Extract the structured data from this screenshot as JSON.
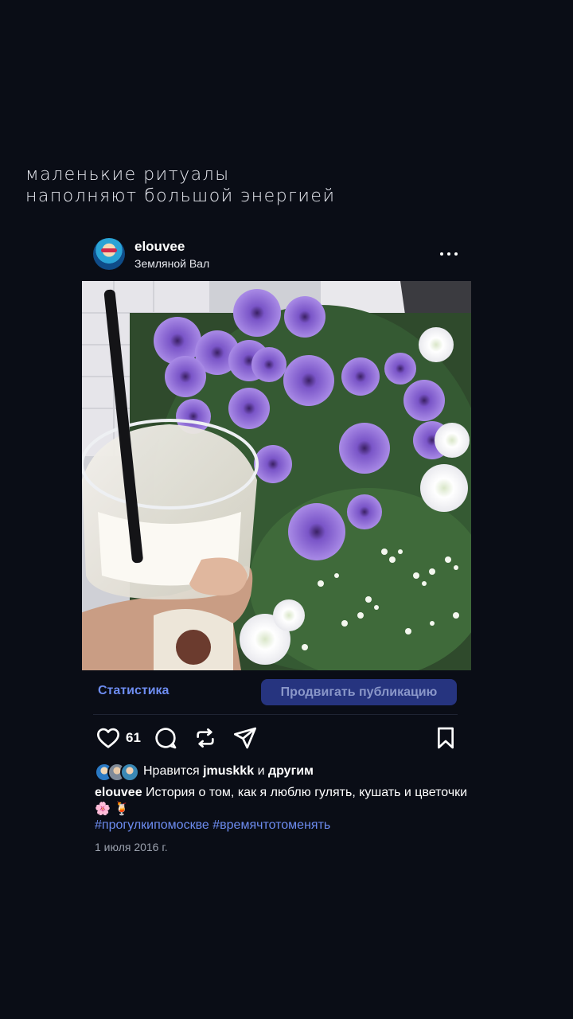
{
  "quote": {
    "line1": "маленькие ритуалы",
    "line2": "наполняют большой энергией"
  },
  "post": {
    "username": "elouvee",
    "location": "Земляной Вал",
    "stats_label": "Статистика",
    "promote_label": "Продвигать публикацию",
    "likes_count": "61",
    "liked_prefix": "Нравится",
    "liked_user": "jmuskkk",
    "liked_and": "и",
    "liked_others": "другим",
    "caption_user": "elouvee",
    "caption_text": "История о том, как я люблю гулять, кушать и цветочки🌸 🍹",
    "hashtags": "#прогулкипомоскве #времячтотоменять",
    "date": "1 июля 2016 г."
  },
  "colors": {
    "background": "#0a0d16",
    "link_blue": "#6d8cf0",
    "promote_bg": "#26347f"
  },
  "icons": [
    "more-icon",
    "heart-icon",
    "comment-icon",
    "repost-icon",
    "share-icon",
    "bookmark-icon"
  ]
}
